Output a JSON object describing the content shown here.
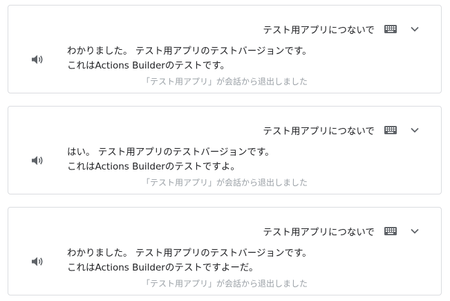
{
  "colors": {
    "border": "#dadce0",
    "text": "#202124",
    "muted": "#9aa0a6",
    "icon": "#5f6368"
  },
  "cards": [
    {
      "query": "テスト用アプリにつないで",
      "response_line1": "わかりました。 テスト用アプリのテストバージョンです。",
      "response_line2": "これはActions Builderのテストです。",
      "status": "「テスト用アプリ」が会話から退出しました",
      "icons": [
        "speaker-icon",
        "keyboard-icon",
        "chevron-down-icon"
      ]
    },
    {
      "query": "テスト用アプリにつないで",
      "response_line1": "はい。 テスト用アプリのテストバージョンです。",
      "response_line2": "これはActions Builderのテストですよ。",
      "status": "「テスト用アプリ」が会話から退出しました",
      "icons": [
        "speaker-icon",
        "keyboard-icon",
        "chevron-down-icon"
      ]
    },
    {
      "query": "テスト用アプリにつないで",
      "response_line1": "わかりました。 テスト用アプリのテストバージョンです。",
      "response_line2": "これはActions Builderのテストですよーだ。",
      "status": "「テスト用アプリ」が会話から退出しました",
      "icons": [
        "speaker-icon",
        "keyboard-icon",
        "chevron-down-icon"
      ]
    }
  ]
}
